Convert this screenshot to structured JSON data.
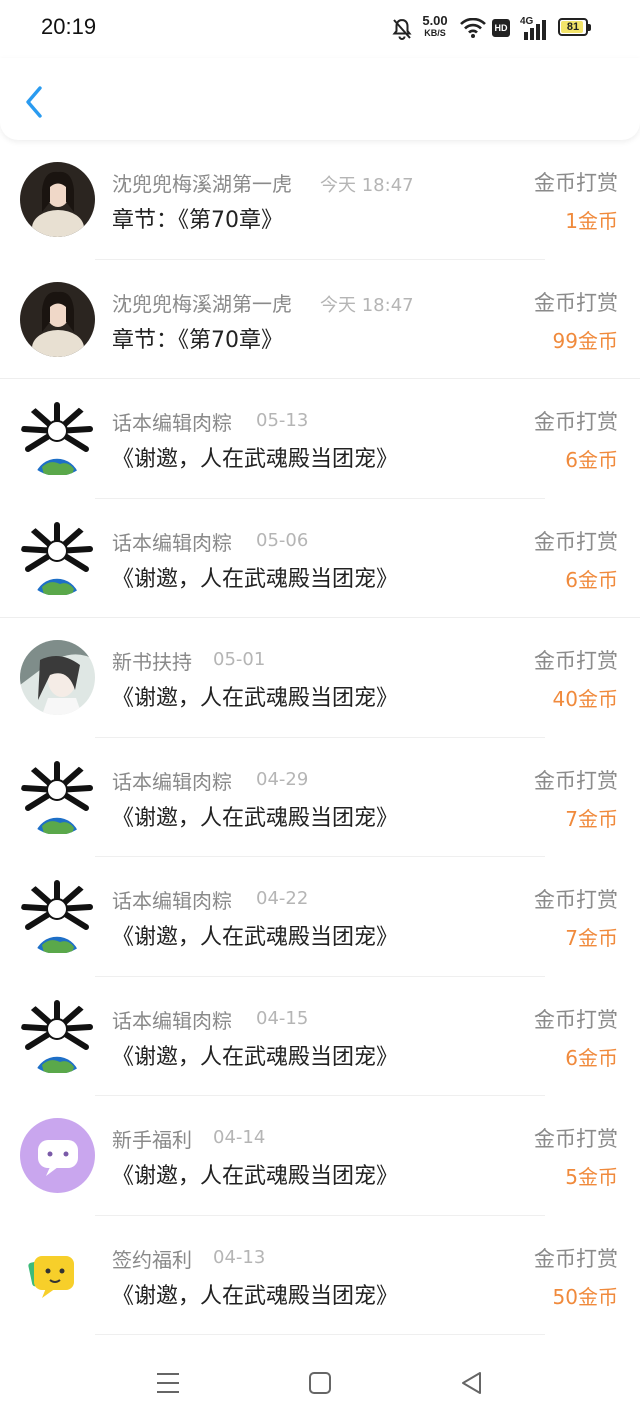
{
  "status_bar": {
    "time": "20:19",
    "net_speed": "5.00",
    "net_unit": "KB/S",
    "hd": "HD",
    "signal": "4G",
    "battery": "81"
  },
  "nav": {
    "back_icon": "chevron-left-icon"
  },
  "records": [
    {
      "name": "沈兜兜梅溪湖第一虎",
      "date": "今天 18:47",
      "title": "章节：《第70章》",
      "type": "金币打赏",
      "amount": "1金币"
    },
    {
      "name": "沈兜兜梅溪湖第一虎",
      "date": "今天 18:47",
      "title": "章节：《第70章》",
      "type": "金币打赏",
      "amount": "99金币"
    },
    {
      "name": "话本编辑肉粽",
      "date": "05-13",
      "title": "《谢邀，人在武魂殿当团宠》",
      "type": "金币打赏",
      "amount": "6金币"
    },
    {
      "name": "话本编辑肉粽",
      "date": "05-06",
      "title": "《谢邀，人在武魂殿当团宠》",
      "type": "金币打赏",
      "amount": "6金币"
    },
    {
      "name": "新书扶持",
      "date": "05-01",
      "title": "《谢邀，人在武魂殿当团宠》",
      "type": "金币打赏",
      "amount": "40金币"
    },
    {
      "name": "话本编辑肉粽",
      "date": "04-29",
      "title": "《谢邀，人在武魂殿当团宠》",
      "type": "金币打赏",
      "amount": "7金币"
    },
    {
      "name": "话本编辑肉粽",
      "date": "04-22",
      "title": "《谢邀，人在武魂殿当团宠》",
      "type": "金币打赏",
      "amount": "7金币"
    },
    {
      "name": "话本编辑肉粽",
      "date": "04-15",
      "title": "《谢邀，人在武魂殿当团宠》",
      "type": "金币打赏",
      "amount": "6金币"
    },
    {
      "name": "新手福利",
      "date": "04-14",
      "title": "《谢邀，人在武魂殿当团宠》",
      "type": "金币打赏",
      "amount": "5金币"
    },
    {
      "name": "签约福利",
      "date": "04-13",
      "title": "《谢邀，人在武魂殿当团宠》",
      "type": "金币打赏",
      "amount": "50金币"
    }
  ],
  "colors": {
    "accent_blue": "#2a9bf0",
    "amount_orange": "#f08a3c"
  },
  "bottom_nav": [
    "menu-icon",
    "home-square-icon",
    "back-triangle-icon"
  ]
}
